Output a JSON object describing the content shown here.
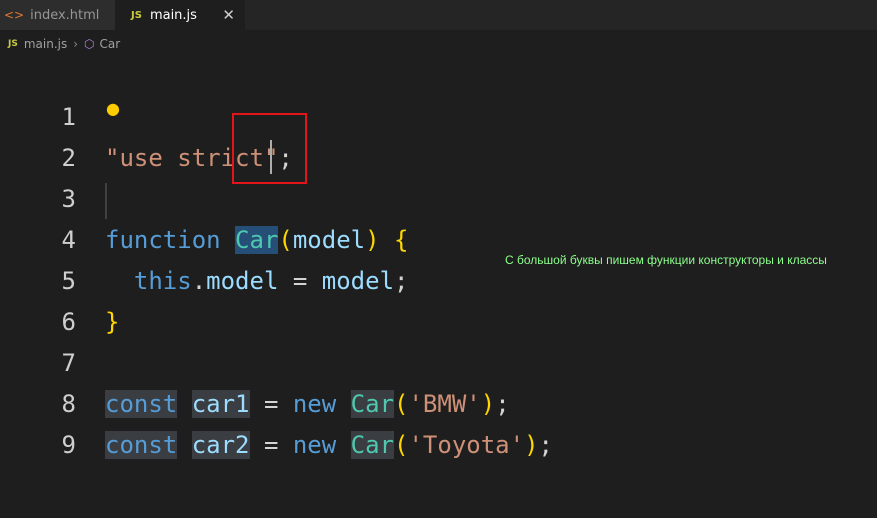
{
  "tabs": [
    {
      "icon": "html-file-icon",
      "label": "index.html",
      "active": false
    },
    {
      "icon": "js-file-icon",
      "label": "main.js",
      "active": true
    }
  ],
  "tab_icon_html": "<>",
  "tab_icon_js": "JS",
  "close_glyph": "✕",
  "breadcrumb": {
    "file": "main.js",
    "symbol": "Car"
  },
  "lines": [
    {
      "num": "1"
    },
    {
      "num": "2"
    },
    {
      "num": "3"
    },
    {
      "num": "4"
    },
    {
      "num": "5"
    },
    {
      "num": "6"
    },
    {
      "num": "7"
    },
    {
      "num": "8"
    },
    {
      "num": "9"
    }
  ],
  "code": {
    "l1": {
      "str": "\"use strict\"",
      "semi": ";"
    },
    "l3": {
      "kw": "function",
      "name": "Car",
      "open": "(",
      "param": "model",
      "close": ")",
      "brace": "{"
    },
    "l4": {
      "this": "this",
      "dot": ".",
      "prop": "model",
      "eq": "=",
      "val": "model",
      "semi": ";"
    },
    "l5": {
      "brace": "}"
    },
    "l7": {
      "kw": "const",
      "var": "car1",
      "eq": "=",
      "new": "new",
      "cls": "Car",
      "open": "(",
      "arg": "'BMW'",
      "close": ")",
      "semi": ";"
    },
    "l8": {
      "kw": "const",
      "var": "car2",
      "eq": "=",
      "new": "new",
      "cls": "Car",
      "open": "(",
      "arg": "'Toyota'",
      "close": ")",
      "semi": ";"
    }
  },
  "annotation": "С большой буквы пишем функции конструкторы и классы",
  "colors": {
    "keyword": "#569cd6",
    "string": "#ce9178",
    "class": "#4ec9b0",
    "variable": "#9cdcfe",
    "highlight_box": "#e3151a",
    "annotation": "#8cff8c"
  }
}
